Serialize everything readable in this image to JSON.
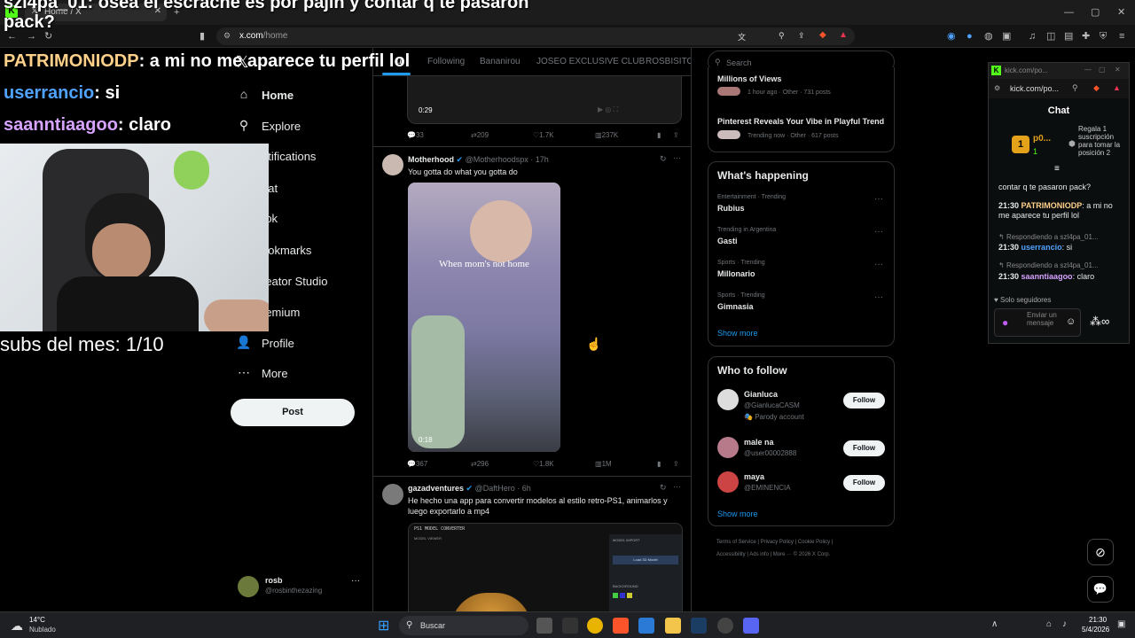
{
  "browser": {
    "tab_title": "Home / X",
    "url_host": "x.com",
    "url_path": "/home"
  },
  "overlay": {
    "top_line": "szl4pa_01: osea el escrache es por pajin y contar q te pasaron",
    "top_line2": "pack?",
    "chat": [
      {
        "user": "PATRIMONIODP",
        "text": ": a mi no me aparece tu perfil lol",
        "color": "#ffd08a"
      },
      {
        "user": "userrancio",
        "text": ": si",
        "color": "#4fa3ff"
      },
      {
        "user": "saanntiaagoo",
        "text": ": claro",
        "color": "#d6a3ff"
      }
    ],
    "subs": "subs del mes: 1/10"
  },
  "nav": {
    "items": [
      {
        "icon": "⌂",
        "label": "Home"
      },
      {
        "icon": "⚲",
        "label": "Explore"
      },
      {
        "icon": "🔔",
        "label": "otifications"
      },
      {
        "icon": "✉",
        "label": "hat"
      },
      {
        "icon": "◧",
        "label": "rok"
      },
      {
        "icon": "🔖",
        "label": "ookmarks"
      },
      {
        "icon": "⚡",
        "label": "reator Studio"
      },
      {
        "icon": "✔",
        "label": "remium"
      },
      {
        "icon": "👤",
        "label": "Profile"
      },
      {
        "icon": "⋯",
        "label": "More"
      }
    ],
    "post": "Post",
    "account_name": "rosb",
    "account_handle": "@rosbinthezazing"
  },
  "feed": {
    "tabs": [
      "u",
      "Following",
      "Bananirou",
      "JOSEO EXCLUSIVE CLUB",
      "ROSBISITOS"
    ],
    "tweet0": {
      "time": "0:29",
      "replies": "33",
      "reposts": "209",
      "likes": "1.7K",
      "views": "237K"
    },
    "tweet1": {
      "name": "Motherhood",
      "handle": "@Motherhoodspx · 17h",
      "text": "You gotta do what you gotta do",
      "video_caption": "When mom's not home",
      "time": "0:18",
      "replies": "367",
      "reposts": "296",
      "likes": "1.8K",
      "views": "1M"
    },
    "tweet2": {
      "name": "gazadventures",
      "handle": "@DaftHero · 6h",
      "text": "He hecho una app para convertir modelos al estilo retro-PS1, animarlos y luego exportarlo a mp4",
      "app_title": "PS1 MODEL CONVERTER",
      "panel1": "MODEL VIEWER",
      "panel2": "MODEL IMPORT",
      "button": "Load 3D Model",
      "panel3": "BACKGROUND"
    }
  },
  "right": {
    "search_placeholder": "Search",
    "top_items": [
      {
        "title": "Millions of Views",
        "meta": "1 hour ago · Other · 731 posts"
      },
      {
        "title": "Pinterest Reveals Your Vibe in Playful Trend",
        "meta": "Trending now · Other · 617 posts"
      }
    ],
    "happening_title": "What's happening",
    "trends": [
      {
        "meta": "Entertainment · Trending",
        "name": "Rubius"
      },
      {
        "meta": "Trending in Argentina",
        "name": "Gasti"
      },
      {
        "meta": "Sports · Trending",
        "name": "Millonario"
      },
      {
        "meta": "Sports · Trending",
        "name": "Gimnasia"
      }
    ],
    "show_more": "Show more",
    "who_title": "Who to follow",
    "follow": [
      {
        "name": "Gianluca",
        "handle": "@GianlucaCASM",
        "extra": "Parody account"
      },
      {
        "name": "male na",
        "handle": "@user00002888",
        "extra": ""
      },
      {
        "name": "maya",
        "handle": "@EMINENCIA",
        "extra": ""
      }
    ],
    "follow_label": "Follow",
    "footer1": "Terms of Service  |  Privacy Policy  |  Cookie Policy  |",
    "footer2": "Accessibility  |  Ads info  |  More ···  © 2026 X Corp."
  },
  "kick": {
    "title_bar": "kick.com/po...",
    "url": "kick.com/po...",
    "chat_label": "Chat",
    "top_name": "p0...",
    "top_count": "1",
    "gift_text": "Regala 1 suscripción para tomar la posición 2",
    "msg0": "contar q te pasaron pack?",
    "msgs": [
      {
        "time": "21:30",
        "user": "PATRIMONIODP",
        "text": ": a mi no me aparece tu perfil lol"
      },
      {
        "reply": "Respondiendo a szl4pa_01..."
      },
      {
        "time": "21:30",
        "user": "userrancio",
        "text": ": si"
      },
      {
        "reply": "Respondiendo a szl4pa_01..."
      },
      {
        "time": "21:30",
        "user": "saanntiaagoo",
        "text": ": claro"
      }
    ],
    "followers_only": "Solo seguidores",
    "input_placeholder": "Enviar un mensaje"
  },
  "taskbar": {
    "temp": "14°C",
    "weather": "Nublado",
    "search": "Buscar",
    "time": "21:30",
    "date": "5/4/2026"
  }
}
